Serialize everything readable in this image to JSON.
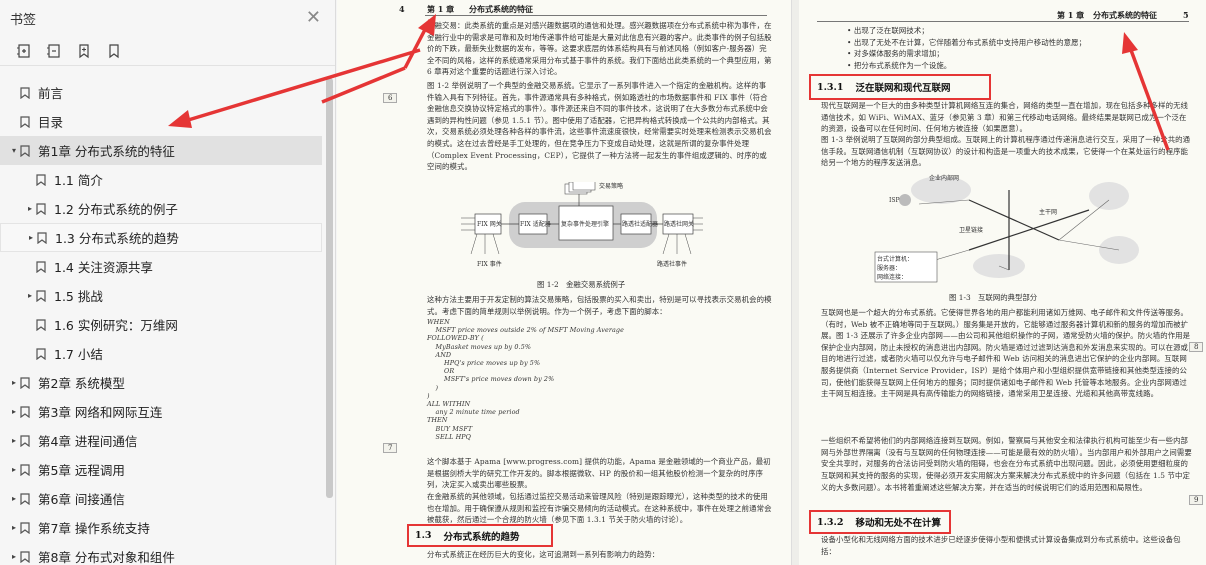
{
  "sidebar": {
    "title": "书签",
    "items": [
      {
        "label": "前言",
        "level": 0,
        "expander": ""
      },
      {
        "label": "目录",
        "level": 0,
        "expander": ""
      },
      {
        "label": "第1章 分布式系统的特征",
        "level": 0,
        "expander": "▾",
        "active": true
      },
      {
        "label": "1.1 简介",
        "level": 1,
        "expander": ""
      },
      {
        "label": "1.2 分布式系统的例子",
        "level": 1,
        "expander": "▸"
      },
      {
        "label": "1.3 分布式系统的趋势",
        "level": 1,
        "expander": "▸",
        "hover": true
      },
      {
        "label": "1.4 关注资源共享",
        "level": 1,
        "expander": ""
      },
      {
        "label": "1.5 挑战",
        "level": 1,
        "expander": "▸"
      },
      {
        "label": "1.6 实例研究：万维网",
        "level": 1,
        "expander": ""
      },
      {
        "label": "1.7 小结",
        "level": 1,
        "expander": ""
      },
      {
        "label": "第2章 系统模型",
        "level": 0,
        "expander": "▸"
      },
      {
        "label": "第3章 网络和网际互连",
        "level": 0,
        "expander": "▸"
      },
      {
        "label": "第4章 进程间通信",
        "level": 0,
        "expander": "▸"
      },
      {
        "label": "第5章 远程调用",
        "level": 0,
        "expander": "▸"
      },
      {
        "label": "第6章 间接通信",
        "level": 0,
        "expander": "▸"
      },
      {
        "label": "第7章 操作系统支持",
        "level": 0,
        "expander": "▸"
      },
      {
        "label": "第8章 分布式对象和组件",
        "level": 0,
        "expander": "▸"
      }
    ]
  },
  "left_page": {
    "page_num": "4",
    "chapter": "第 1 章",
    "chapter_title": "分布式系统的特征",
    "margin_nums": [
      "6",
      "7"
    ],
    "para1": "金融交易：此类系统的重点是对感兴趣数据项的通信和处理。感兴趣数据项在分布式系统中称为事件，在金融行业中的需求是可靠和及时地传递事件给可能是大量对此信息有兴趣的客户。此类事件的例子包括股价的下跌，最新失业数据的发布，等等。这要求底层的体系结构具有与前述风格（例如客户-服务器）完全不同的风格，这样的系统通常采用分布式基于事件的系统。我们下面给出此类系统的一个典型应用，第 6 章再对这个重要的话题进行深入讨论。",
    "para2": "图 1-2 举例说明了一个典型的金融交易系统。它显示了一系列事件进入一个指定的金融机构。这样的事件输入具有下列特征。首先，事件源通常具有多种格式，例如路透社的市场数据事件和 FIX 事件（符合金融信息交换协议特定格式的事件）。事件源还来自不同的事件技术，这说明了在大多数分布式系统中会遇到的异构性问题（参见 1.5.1 节）。图中使用了适配器，它把异构格式转换成一个公共的内部格式。其次，交易系统必须处理各种各样的事件流，这些事件流速度很快，经常需要实时处理来检测表示交易机会的模式。这在过去曾经是手工处理的，但在竞争压力下变成自动处理，这就是所谓的复杂事件处理（Complex Event Processing，CEP），它提供了一种方法将一起发生的事件组成逻辑的、时序的或空间的模式。",
    "figure_labels": [
      "交易策略",
      "FIX 网关",
      "FIX 适配器",
      "复杂事件处理引擎",
      "路透社适配器",
      "路透社网关",
      "FIX 事件",
      "路透社事件"
    ],
    "figure_caption": "图 1-2　金融交易系统例子",
    "para3": "这种方法主要用于开发定制的算法交易策略，包括股票的买入和卖出，特别是可以寻找表示交易机会的模式。考虑下面的简单规则以举例说明。作为一个例子，考虑下面的脚本：",
    "code": [
      "WHEN",
      "    MSFT price moves outside 2% of MSFT Moving Average",
      "FOLLOWED-BY (",
      "    MyBasket moves up by 0.5%",
      "    AND",
      "        HPQ's price moves up by 5%",
      "        OR",
      "        MSFT's price moves down by 2%",
      "    )",
      ")",
      "ALL WITHIN",
      "    any 2 minute time period",
      "THEN",
      "    BUY MSFT",
      "    SELL HPQ"
    ],
    "para4": "这个脚本基于 Apama [www.progress.com] 提供的功能，Apama 是金融领域的一个商业产品，最初是根据剑桥大学的研究工作开发的。脚本根据微软、HP 的股价和一组其他股价检测一个复杂的时序序列，决定买入或卖出哪些股票。",
    "para5": "在金融系统的其他领域，包括通过监控交易活动来管理风险（特别是跟踪曝光），这种类型的技术的使用也在增加。用于确保遵从规则和监控有诈骗交易倾向的活动模式。在这种系统中，事件在处理之前通常会被截获，然后通过一个合规的防火墙（参见下面 1.3.1 节关于防火墙的讨论）。",
    "section_num": "1.3",
    "section_title": "分布式系统的趋势",
    "para6": "分布式系统正在经历巨大的变化，这可追溯到一系列有影响力的趋势："
  },
  "right_page": {
    "page_num": "5",
    "chapter": "第 1 章",
    "chapter_title": "分布式系统的特征",
    "bullets": [
      "出现了泛在联网技术；",
      "出现了无处不在计算，它伴随着分布式系统中支持用户移动性的意愿；",
      "对多媒体服务的需求增加；",
      "把分布式系统作为一个设施。"
    ],
    "section1_num": "1.3.1",
    "section1_title": "泛在联网和现代互联网",
    "para1": "现代互联网是一个巨大的由多种类型计算机网络互连的集合，网络的类型一直在增加，现在包括多种多样的无线通信技术，如 WiFi、WiMAX、蓝牙（参见第 3 章）和第三代移动电话网络。最终结果是联网已成为一个泛在的资源，设备可以在任何时间、任何地方被连接（如果愿意）。",
    "para2": "图 1-3 举例说明了互联网的部分典型组成。互联网上的计算机程序通过传递消息进行交互，采用了一种公共的通信手段。互联网通信机制（互联网协议）的设计和构造是一项重大的技术成果，它使得一个在某处运行的程序能给另一个地方的程序发送消息。",
    "figure_labels": [
      "企业内部网",
      "ISP",
      "主干网",
      "卫星链接",
      "台式计算机：",
      "服务器：",
      "网络连接："
    ],
    "figure_caption": "图 1-3　互联网的典型部分",
    "margin_nums": [
      "8",
      "9"
    ],
    "para3": "互联网也是一个超大的分布式系统。它使得世界各地的用户都能利用诸如万维网、电子邮件和文件传送等服务。（有时，Web 被不正确地等同于互联网。）服务集是开放的，它能够通过服务器计算机和新的服务的增加而被扩展。图 1-3 还展示了许多企业内部网——由公司和其他组织操作的子网，通常受防火墙的保护。防火墙的作用是保护企业内部网，防止未授权的消息进出内部网。防火墙是通过过滤到达消息和外发消息来实现的。可以在源或目的地进行过滤，或者防火墙可以仅允许与电子邮件和 Web 访问相关的消息进出它保护的企业内部网。互联网服务提供商（Internet Service Provider，ISP）是给个体用户和小型组织提供宽带链接和其他类型连接的公司，使他们能获得互联网上任何地方的服务；同时提供诸如电子邮件和 Web 托管等本地服务。企业内部网通过主干网互相连接。主干网是具有高传输能力的网络链接，通常采用卫星连接、光缆和其他高带宽线路。",
    "para4": "一些组织不希望将他们的内部网络连接到互联网。例如，警察局与其他安全和法律执行机构可能至少有一些内部网与外部世界隔离（没有与互联网的任何物理连接——可能是最有效的防火墙）。当内部用户和外部用户之间需要安全共享时，对服务的合法访问受到防火墙的阻碍，也会在分布式系统中出现问题。因此，必须使用更细粒度的机制和策略（见第 11 章的讨论）作为防火墙的补充。",
    "para5": "互联网和其支持的服务的实现，使得必须开发实用解决方案来解决分布式系统中的许多问题（包括在 1.5 节中定义的大多数问题）。本书将着重阐述这些解决方案，并在适当的时候说明它们的适用范围和局限性。",
    "section2_num": "1.3.2",
    "section2_title": "移动和无处不在计算",
    "para6": "设备小型化和无线网络方面的技术进步已经逐步使得小型和便携式计算设备集成到分布式系统中。这些设备包括："
  }
}
